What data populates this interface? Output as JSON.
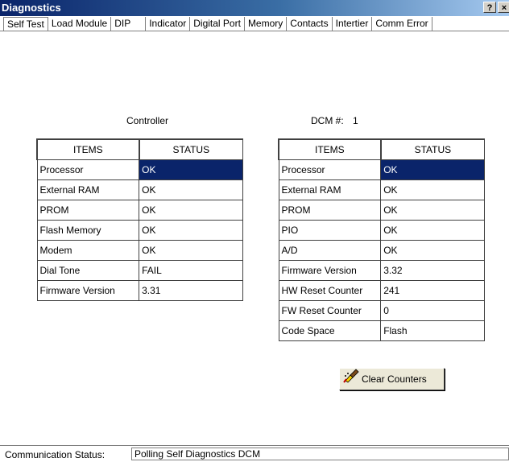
{
  "window": {
    "title": "Diagnostics",
    "help_label": "?",
    "close_label": "×"
  },
  "tabs": [
    {
      "label": "Self Test",
      "active": true
    },
    {
      "label": "Load Module"
    },
    {
      "label": "DIP"
    },
    {
      "label": "Indicator"
    },
    {
      "label": "Digital Port"
    },
    {
      "label": "Memory"
    },
    {
      "label": "Contacts"
    },
    {
      "label": "Intertier"
    },
    {
      "label": "Comm Error"
    }
  ],
  "controller": {
    "heading": "Controller",
    "col_items": "ITEMS",
    "col_status": "STATUS",
    "rows": [
      {
        "item": "Processor",
        "status": "OK"
      },
      {
        "item": "External RAM",
        "status": "OK"
      },
      {
        "item": "PROM",
        "status": "OK"
      },
      {
        "item": "Flash Memory",
        "status": "OK"
      },
      {
        "item": "Modem",
        "status": "OK"
      },
      {
        "item": "Dial Tone",
        "status": "FAIL"
      },
      {
        "item": "Firmware Version",
        "status": "3.31"
      }
    ]
  },
  "dcm": {
    "heading_label": "DCM #:",
    "heading_value": "1",
    "col_items": "ITEMS",
    "col_status": "STATUS",
    "rows": [
      {
        "item": "Processor",
        "status": "OK"
      },
      {
        "item": "External RAM",
        "status": "OK"
      },
      {
        "item": "PROM",
        "status": "OK"
      },
      {
        "item": "PIO",
        "status": "OK"
      },
      {
        "item": "A/D",
        "status": "OK"
      },
      {
        "item": "Firmware Version",
        "status": "3.32"
      },
      {
        "item": "HW Reset Counter",
        "status": "241"
      },
      {
        "item": "FW Reset Counter",
        "status": "0"
      },
      {
        "item": "Code Space",
        "status": "Flash"
      }
    ]
  },
  "actions": {
    "clear_counters_label": "Clear Counters"
  },
  "status_bar": {
    "label": "Communication Status:",
    "value": "Polling Self Diagnostics DCM"
  }
}
